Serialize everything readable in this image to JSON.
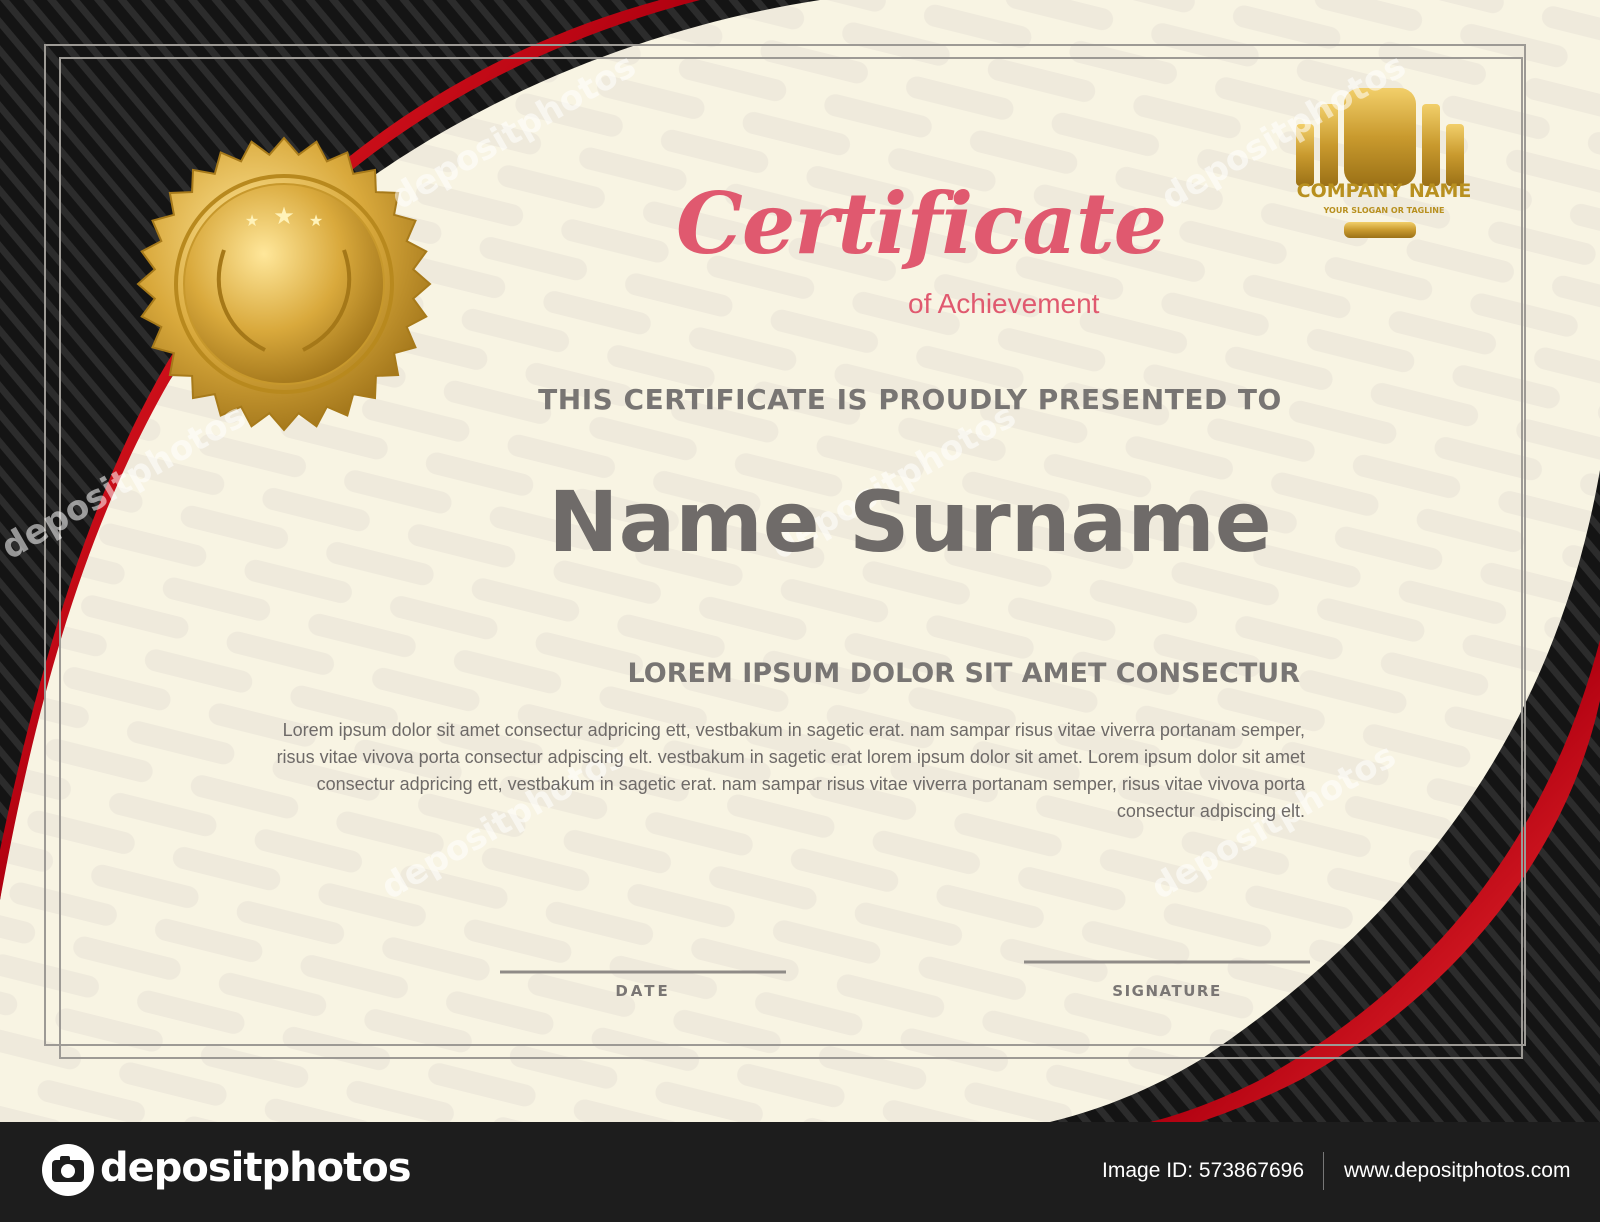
{
  "certificate": {
    "title": "Certificate",
    "subtitle": "of Achievement",
    "presented_text": "THIS CERTIFICATE IS PROUDLY PRESENTED TO",
    "recipient_name": "Name Surname",
    "heading": "LOREM IPSUM DOLOR SIT AMET CONSECTUR",
    "body": "Lorem ipsum dolor sit amet consectur adpricing ett, vestbakum in sagetic erat. nam sampar risus vitae viverra portanam semper, risus vitae vivova porta consectur adpiscing elt. vestbakum in sagetic erat lorem ipsum dolor sit amet. Lorem ipsum dolor sit amet consectur adpricing ett, vestbakum in sagetic erat. nam sampar risus vitae viverra portanam semper, risus vitae vivova porta consectur adpiscing elt.",
    "date_label": "DATE",
    "signature_label": "SIGNATURE"
  },
  "logo": {
    "name": "COMPANY NAME",
    "slogan": "YOUR SLOGAN OR TAGLINE",
    "icon": "gold-bars-logo-icon"
  },
  "seal": {
    "icon": "gold-seal-laurel-stars-icon"
  },
  "watermark": {
    "text": "depositphotos"
  },
  "footer": {
    "brand": "depositphotos",
    "image_id": "Image ID: 573867696",
    "url": "www.depositphotos.com"
  },
  "colors": {
    "background": "#f8f4e3",
    "accent_red": "#d0121b",
    "dark": "#161616",
    "title_pink": "#e0596f",
    "gold": "#c9a030",
    "text_gray": "#787573",
    "footer_bg": "#1d1d1d"
  }
}
